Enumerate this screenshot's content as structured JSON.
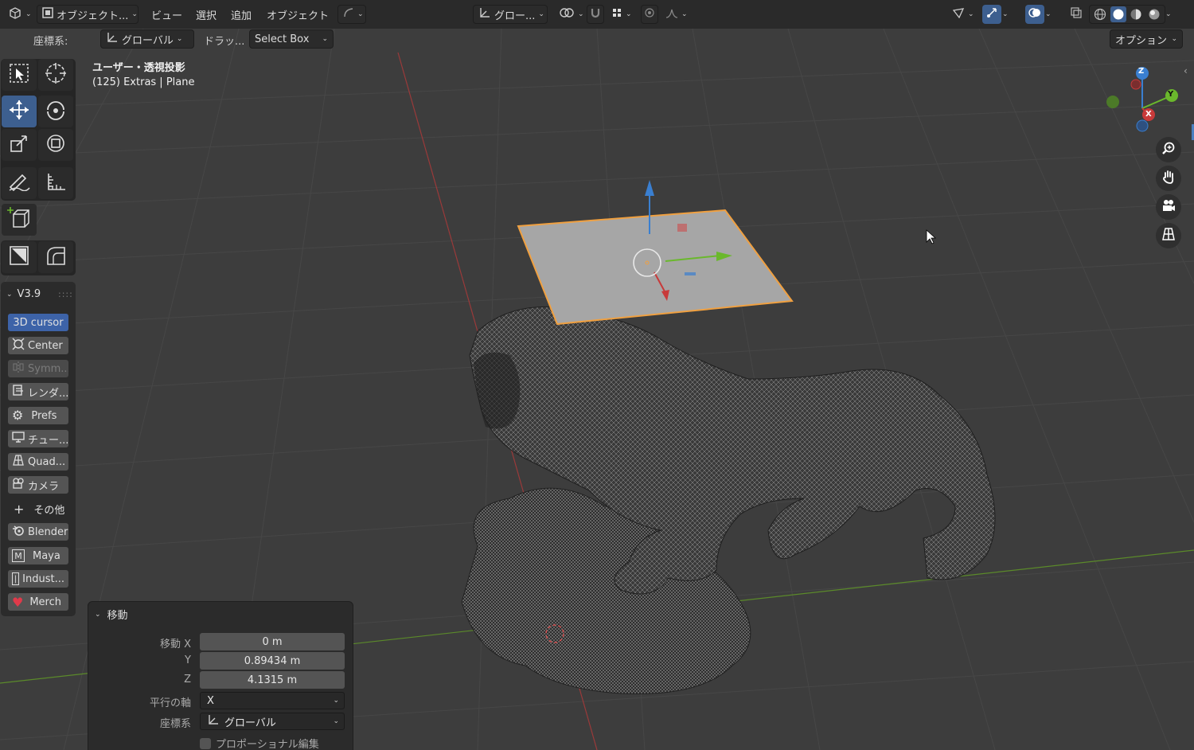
{
  "header": {
    "editor_icon": "cube-icon",
    "mode": "オブジェクト...",
    "menus": [
      "ビュー",
      "選択",
      "追加",
      "オブジェクト"
    ],
    "orientation": "グロー...",
    "options_label": "オプション"
  },
  "tool_header": {
    "coord_label": "座標系:",
    "coord_value": "グローバル",
    "drag_label": "ドラッ...",
    "drag_value": "Select Box"
  },
  "overlay_text": {
    "view_name": "ユーザー・透視投影",
    "collection": "(125) Extras | Plane"
  },
  "sidebar_panel": {
    "title": "V3.9",
    "buttons": [
      {
        "label": "3D cursor",
        "icon": "none",
        "active": true
      },
      {
        "label": "Center",
        "icon": "center-icon"
      },
      {
        "label": "Symm...",
        "icon": "symmetry-icon",
        "disabled": true
      },
      {
        "label": "レンダ...",
        "icon": "render-icon"
      },
      {
        "label": "Prefs",
        "icon": "gear-icon"
      },
      {
        "label": "チュー...",
        "icon": "monitor-icon"
      },
      {
        "label": "Quad...",
        "icon": "quad-icon"
      },
      {
        "label": "カメラ",
        "icon": "camera-icon"
      },
      {
        "label": "その他",
        "icon": "plus-icon"
      },
      {
        "label": "Blender",
        "icon": "blender-icon"
      },
      {
        "label": "Maya",
        "icon": "maya-icon"
      },
      {
        "label": "Indust...",
        "icon": "industry-icon"
      },
      {
        "label": "Merch",
        "icon": "heart-icon"
      }
    ]
  },
  "operator_panel": {
    "title": "移動",
    "move_x_label": "移動 X",
    "move_x": "0 m",
    "y_label": "Y",
    "move_y": "0.89434 m",
    "z_label": "Z",
    "move_z": "4.1315 m",
    "axis_label": "平行の軸",
    "axis_value": "X",
    "coord_label": "座標系",
    "coord_value": "グローバル",
    "proportional_label": "プロポーショナル編集"
  },
  "gizmo": {
    "x": "X",
    "y": "Y",
    "z": "Z"
  },
  "colors": {
    "active_blue": "#3d5f8f",
    "selection_orange": "#f0a040",
    "x_axis": "#c83a3a",
    "y_axis": "#6ab82c",
    "z_axis": "#3a7fd0"
  }
}
